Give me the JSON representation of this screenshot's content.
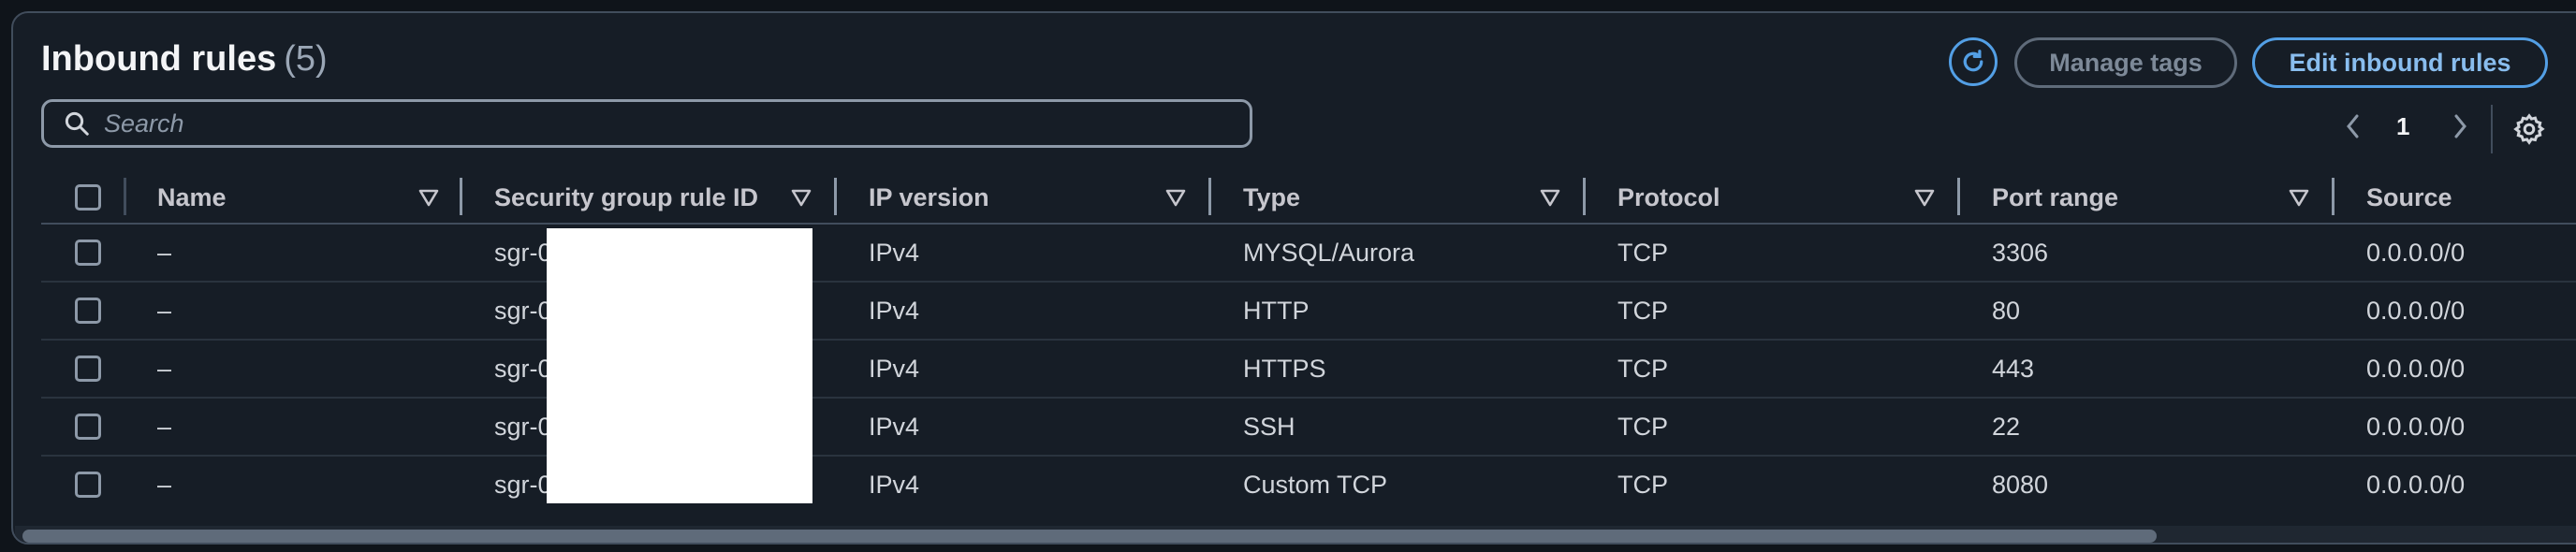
{
  "header": {
    "title": "Inbound rules",
    "count": "(5)",
    "manage_tags_label": "Manage tags",
    "edit_label": "Edit inbound rules"
  },
  "search": {
    "placeholder": "Search"
  },
  "pagination": {
    "current_page": "1"
  },
  "table": {
    "columns": [
      "Name",
      "Security group rule ID",
      "IP version",
      "Type",
      "Protocol",
      "Port range",
      "Source"
    ],
    "rows": [
      {
        "name": "–",
        "rule_id": "sgr-0",
        "ip_version": "IPv4",
        "type": "MYSQL/Aurora",
        "protocol": "TCP",
        "port_range": "3306",
        "source": "0.0.0.0/0"
      },
      {
        "name": "–",
        "rule_id": "sgr-0",
        "ip_version": "IPv4",
        "type": "HTTP",
        "protocol": "TCP",
        "port_range": "80",
        "source": "0.0.0.0/0"
      },
      {
        "name": "–",
        "rule_id": "sgr-0",
        "ip_version": "IPv4",
        "type": "HTTPS",
        "protocol": "TCP",
        "port_range": "443",
        "source": "0.0.0.0/0"
      },
      {
        "name": "–",
        "rule_id": "sgr-0",
        "ip_version": "IPv4",
        "type": "SSH",
        "protocol": "TCP",
        "port_range": "22",
        "source": "0.0.0.0/0"
      },
      {
        "name": "–",
        "rule_id": "sgr-0",
        "ip_version": "IPv4",
        "type": "Custom TCP",
        "protocol": "TCP",
        "port_range": "8080",
        "source": "0.0.0.0/0"
      }
    ]
  },
  "colors": {
    "accent": "#539fe5",
    "background": "#161d26",
    "border": "#414d5c"
  },
  "icons": [
    "refresh-icon",
    "search-icon",
    "chevron-left-icon",
    "chevron-right-icon",
    "settings-icon",
    "sort-icon"
  ]
}
